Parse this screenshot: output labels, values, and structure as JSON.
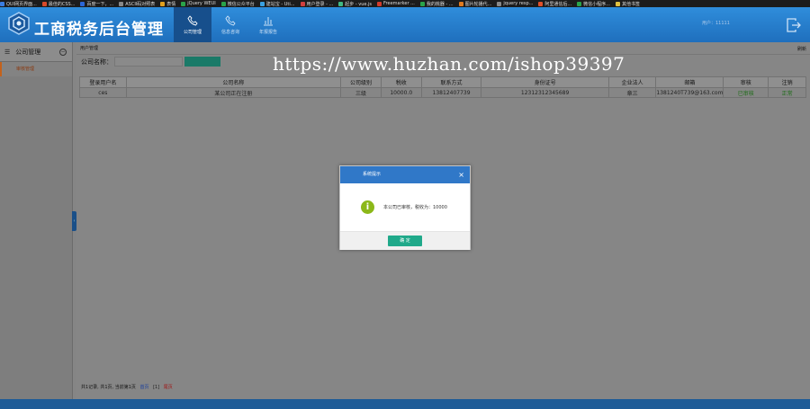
{
  "browser": {
    "bookmarks": [
      {
        "label": "QUI网页界面...",
        "color": "#3b7de0"
      },
      {
        "label": "最佳的CSS...",
        "color": "#d94a2a"
      },
      {
        "label": "百度一下，...",
        "color": "#2c66d6"
      },
      {
        "label": "ASCII码对照表",
        "color": "#888888"
      },
      {
        "label": "表情",
        "color": "#e0a020"
      },
      {
        "label": "jQuery WEUI",
        "color": "#2aa34a"
      },
      {
        "label": "微信公众平台",
        "color": "#2aa34a"
      },
      {
        "label": "建站宝 - Uti...",
        "color": "#3ba0e0"
      },
      {
        "label": "用户登录 - ...",
        "color": "#d04040"
      },
      {
        "label": "起步 - vue.js",
        "color": "#41b883"
      },
      {
        "label": "Freemarker ...",
        "color": "#d23b2b"
      },
      {
        "label": "我的桃器 - ...",
        "color": "#2aa34a"
      },
      {
        "label": "图片轮播代...",
        "color": "#e07a20"
      },
      {
        "label": "jquery resp...",
        "color": "#888888"
      },
      {
        "label": "阿里通信后...",
        "color": "#e0502a"
      },
      {
        "label": "微信小程序...",
        "color": "#2aa34a"
      },
      {
        "label": "其他书签",
        "color": "#e0c040"
      }
    ]
  },
  "header": {
    "app_title": "工商税务后台管理",
    "nav": [
      {
        "label": "公司管理",
        "icon": "phone-icon",
        "active": true
      },
      {
        "label": "信息咨询",
        "icon": "phone-icon",
        "active": false
      },
      {
        "label": "年报报告",
        "icon": "chart-icon",
        "active": false
      }
    ],
    "user_label": "用户：11111",
    "colors": {
      "bar": "#2f8ddb",
      "active_nav": "#174f8c"
    }
  },
  "sidebar": {
    "title": "公司管理",
    "menu_icon": "☰",
    "collapse_icon": "⊖",
    "items": [
      {
        "label": "审核管理"
      }
    ]
  },
  "main": {
    "breadcrumb": "用户管理",
    "refresh_label": "刷新",
    "search": {
      "label": "公司名称：",
      "value": "",
      "button_label": ""
    },
    "watermark": "https://www.huzhan.com/ishop39397",
    "table": {
      "columns": [
        "登录用户名",
        "公司名称",
        "公司级别",
        "税收",
        "联系方式",
        "身份证号",
        "企业法人",
        "邮箱",
        "审核",
        "注销"
      ],
      "rows": [
        [
          "ces",
          "某公司正在注册",
          "三级",
          "10000.0",
          "13812407739",
          "12312312345689",
          "章三",
          "1381240T739@163.com",
          "已审核",
          "正常"
        ]
      ]
    },
    "pagination": {
      "summary": "共1记录, 共1页, 当前第1页",
      "first": "首页",
      "current": "[1]",
      "last": "尾页"
    }
  },
  "modal": {
    "title": "系统提示",
    "close": "×",
    "icon": "info-icon",
    "message": "本公司已审核，税收为：10000",
    "ok_label": "确 定",
    "colors": {
      "header": "#3078c8",
      "ok": "#20a98a",
      "icon": "#8cb819"
    }
  }
}
